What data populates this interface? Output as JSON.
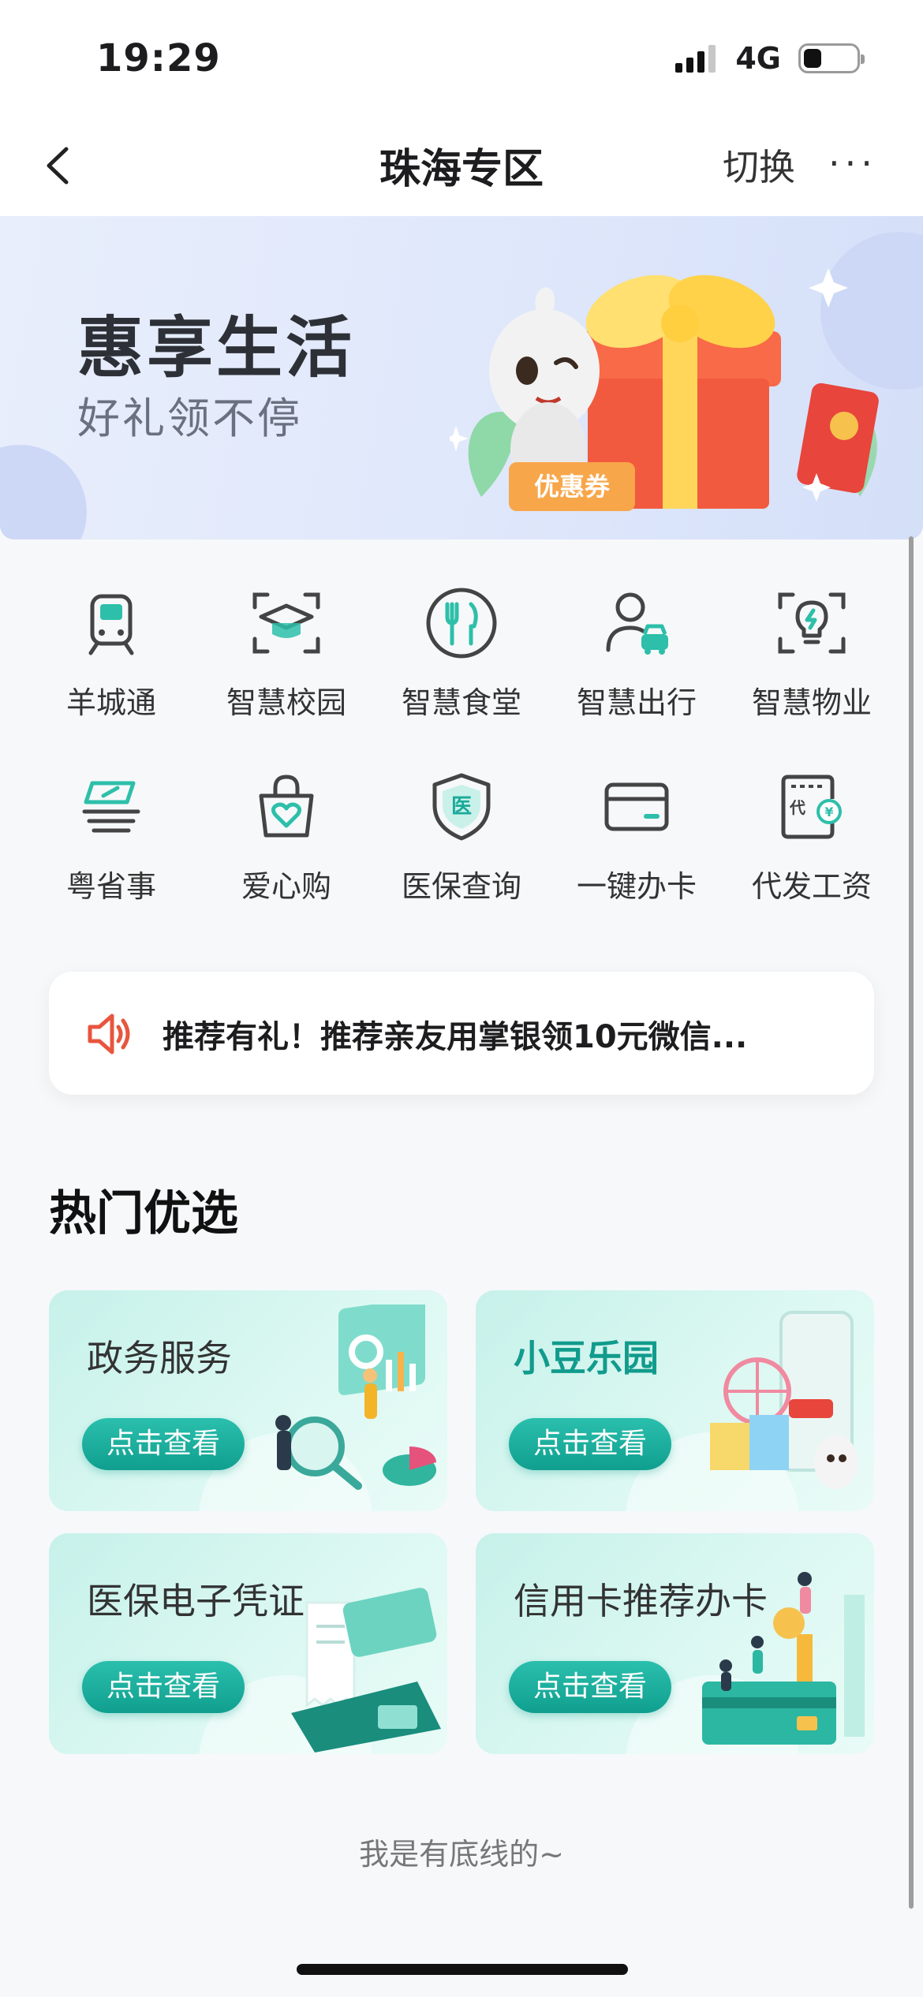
{
  "status": {
    "time": "19:29",
    "network": "4G"
  },
  "nav": {
    "title": "珠海专区",
    "switch_label": "切换",
    "more_label": "···"
  },
  "banner": {
    "title": "惠享生活",
    "subtitle": "好礼领不停",
    "coupon": "优惠券"
  },
  "services": [
    {
      "label": "羊城通",
      "icon": "metro-train-icon"
    },
    {
      "label": "智慧校园",
      "icon": "graduation-cap-icon"
    },
    {
      "label": "智慧食堂",
      "icon": "fork-knife-icon"
    },
    {
      "label": "智慧出行",
      "icon": "user-car-icon"
    },
    {
      "label": "智慧物业",
      "icon": "bulb-icon"
    },
    {
      "label": "粤省事",
      "icon": "card-stack-icon"
    },
    {
      "label": "爱心购",
      "icon": "heart-bag-icon"
    },
    {
      "label": "医保查询",
      "icon": "medical-shield-icon"
    },
    {
      "label": "一键办卡",
      "icon": "bank-card-icon"
    },
    {
      "label": "代发工资",
      "icon": "salary-doc-icon"
    }
  ],
  "notice": {
    "text": "推荐有礼！推荐亲友用掌银领10元微信..."
  },
  "hot": {
    "title": "热门优选",
    "cards": [
      {
        "title": "政务服务",
        "button": "点击查看"
      },
      {
        "title": "小豆乐园",
        "button": "点击查看"
      },
      {
        "title": "医保电子凭证",
        "button": "点击查看"
      },
      {
        "title": "信用卡推荐办卡",
        "button": "点击查看"
      }
    ]
  },
  "footer": {
    "note": "我是有底线的~"
  },
  "colors": {
    "accent": "#1aaa9a",
    "alert": "#e8553e"
  }
}
